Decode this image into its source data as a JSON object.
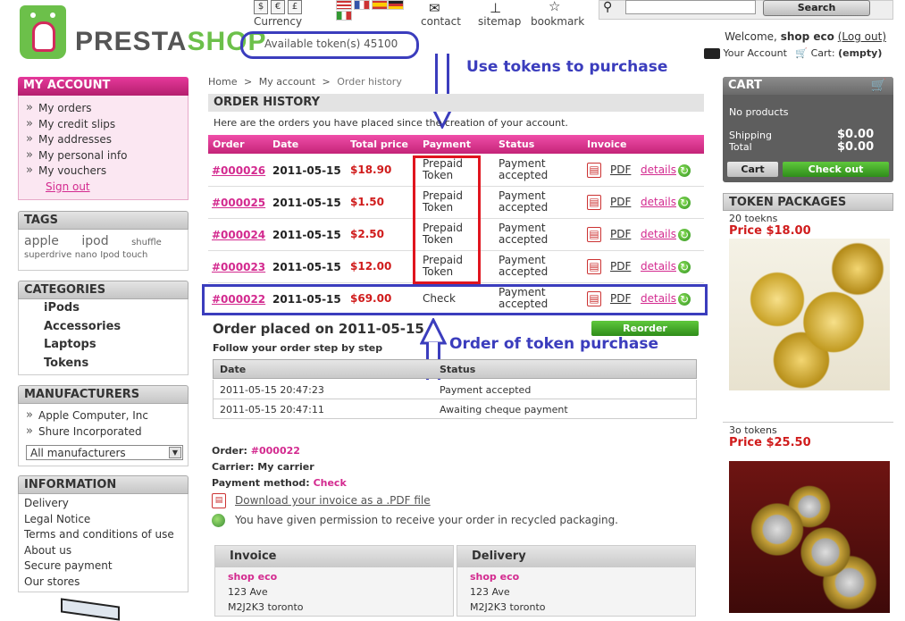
{
  "header": {
    "logo_text_presta": "PRESTA",
    "logo_text_shop": "SHOP",
    "currency_label": "Currency",
    "currency_symbols": [
      "$",
      "€",
      "£"
    ],
    "tokens_label": "Available token(s) 45100",
    "links": {
      "contact": "contact",
      "sitemap": "sitemap",
      "bookmark": "bookmark"
    },
    "search_button": "Search",
    "welcome_prefix": "Welcome,",
    "welcome_user": "shop eco",
    "logout": "(Log out)",
    "your_account": "Your Account",
    "cart_label": "Cart:",
    "cart_status": "(empty)"
  },
  "annotations": {
    "top": "Use tokens to purchase",
    "bottom": "Order of token purchase"
  },
  "my_account": {
    "title": "MY ACCOUNT",
    "items": [
      "My orders",
      "My credit slips",
      "My addresses",
      "My personal info",
      "My vouchers"
    ],
    "signout": "Sign out"
  },
  "tags": {
    "title": "TAGS",
    "row1": [
      "apple",
      "ipod",
      "shuffle"
    ],
    "row2": [
      "superdrive",
      "nano",
      "Ipod touch"
    ]
  },
  "categories": {
    "title": "CATEGORIES",
    "items": [
      "iPods",
      "Accessories",
      "Laptops",
      "Tokens"
    ]
  },
  "manufacturers": {
    "title": "MANUFACTURERS",
    "items": [
      "Apple Computer, Inc",
      "Shure Incorporated"
    ],
    "select_value": "All manufacturers"
  },
  "information": {
    "title": "INFORMATION",
    "items": [
      "Delivery",
      "Legal Notice",
      "Terms and conditions of use",
      "About us",
      "Secure payment",
      "Our stores"
    ]
  },
  "breadcrumb": {
    "home": "Home",
    "account": "My account",
    "current": "Order history",
    "sep": ">"
  },
  "order_history": {
    "title": "ORDER HISTORY",
    "description": "Here are the orders you have placed since the creation of your account.",
    "columns": {
      "order": "Order",
      "date": "Date",
      "total": "Total price",
      "payment": "Payment",
      "status": "Status",
      "invoice": "Invoice"
    },
    "rows": [
      {
        "id": "#000026",
        "date": "2011-05-15",
        "price": "$18.90",
        "pay1": "Prepaid",
        "pay2": "Token",
        "st1": "Payment",
        "st2": "accepted",
        "pdf": "PDF",
        "details": "details"
      },
      {
        "id": "#000025",
        "date": "2011-05-15",
        "price": "$1.50",
        "pay1": "Prepaid",
        "pay2": "Token",
        "st1": "Payment",
        "st2": "accepted",
        "pdf": "PDF",
        "details": "details"
      },
      {
        "id": "#000024",
        "date": "2011-05-15",
        "price": "$2.50",
        "pay1": "Prepaid",
        "pay2": "Token",
        "st1": "Payment",
        "st2": "accepted",
        "pdf": "PDF",
        "details": "details"
      },
      {
        "id": "#000023",
        "date": "2011-05-15",
        "price": "$12.00",
        "pay1": "Prepaid",
        "pay2": "Token",
        "st1": "Payment",
        "st2": "accepted",
        "pdf": "PDF",
        "details": "details"
      },
      {
        "id": "#000022",
        "date": "2011-05-15",
        "price": "$69.00",
        "pay1": "Check",
        "pay2": "",
        "st1": "Payment",
        "st2": "accepted",
        "pdf": "PDF",
        "details": "details"
      }
    ]
  },
  "order_detail": {
    "title": "Order placed on 2011-05-15",
    "reorder": "Reorder",
    "follow": "Follow your order step by step",
    "steps_columns": {
      "date": "Date",
      "status": "Status"
    },
    "steps": [
      {
        "date": "2011-05-15 20:47:23",
        "status": "Payment accepted"
      },
      {
        "date": "2011-05-15 20:47:11",
        "status": "Awaiting cheque payment"
      }
    ],
    "order_label": "Order:",
    "order_value": "#000022",
    "carrier_label": "Carrier:",
    "carrier_value": "My carrier",
    "payment_label": "Payment method:",
    "payment_value": "Check",
    "download": "Download your invoice as a .PDF file",
    "recycled": "You have given permission to receive your order in recycled packaging.",
    "invoice": {
      "title": "Invoice",
      "name": "shop eco",
      "address1": "123 Ave",
      "address2": "M2J2K3 toronto"
    },
    "delivery": {
      "title": "Delivery",
      "name": "shop eco",
      "address1": "123 Ave",
      "address2": "M2J2K3 toronto"
    }
  },
  "cart_block": {
    "title": "CART",
    "empty": "No products",
    "shipping_label": "Shipping",
    "shipping_value": "$0.00",
    "total_label": "Total",
    "total_value": "$0.00",
    "cart_button": "Cart",
    "checkout_button": "Check out"
  },
  "token_packages": {
    "title": "TOKEN PACKAGES",
    "items": [
      {
        "name": "20 toekns",
        "price": "Price $18.00"
      },
      {
        "name": "3o tokens",
        "price": "Price $25.50"
      }
    ]
  }
}
